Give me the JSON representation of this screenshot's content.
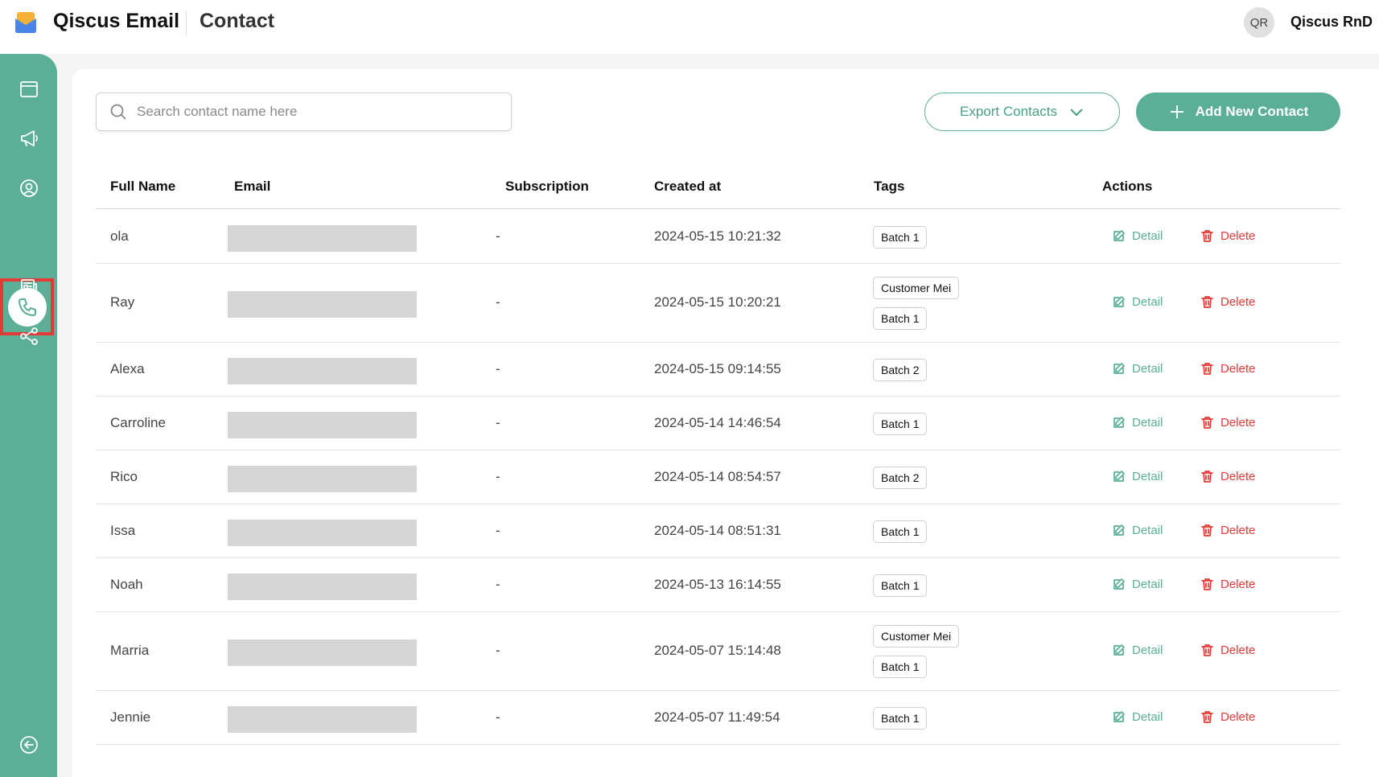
{
  "header": {
    "app_name": "Qiscus Email",
    "page_title": "Contact",
    "user_initials": "QR",
    "user_name": "Qiscus RnD"
  },
  "sidebar": {
    "items": [
      {
        "icon": "browser-window-icon"
      },
      {
        "icon": "megaphone-icon"
      },
      {
        "icon": "user-circle-icon"
      },
      {
        "icon": "phone-icon",
        "active": true
      },
      {
        "icon": "newspaper-icon"
      },
      {
        "icon": "share-nodes-icon"
      }
    ],
    "collapse_icon": "collapse-arrow-icon"
  },
  "toolbar": {
    "search_placeholder": "Search contact name here",
    "export_label": "Export Contacts",
    "add_label": "Add New Contact"
  },
  "table": {
    "columns": [
      "Full Name",
      "Email",
      "Subscription",
      "Created at",
      "Tags",
      "Actions"
    ],
    "detail_label": "Detail",
    "delete_label": "Delete",
    "rows": [
      {
        "name": "ola",
        "subscription": "-",
        "created_at": "2024-05-15 10:21:32",
        "tags": [
          "Batch 1"
        ]
      },
      {
        "name": "Ray",
        "subscription": "-",
        "created_at": "2024-05-15 10:20:21",
        "tags": [
          "Customer Mei",
          "Batch 1"
        ]
      },
      {
        "name": "Alexa",
        "subscription": "-",
        "created_at": "2024-05-15 09:14:55",
        "tags": [
          "Batch 2"
        ]
      },
      {
        "name": "Carroline",
        "subscription": "-",
        "created_at": "2024-05-14 14:46:54",
        "tags": [
          "Batch 1"
        ]
      },
      {
        "name": "Rico",
        "subscription": "-",
        "created_at": "2024-05-14 08:54:57",
        "tags": [
          "Batch 2"
        ]
      },
      {
        "name": "Issa",
        "subscription": "-",
        "created_at": "2024-05-14 08:51:31",
        "tags": [
          "Batch 1"
        ]
      },
      {
        "name": "Noah",
        "subscription": "-",
        "created_at": "2024-05-13 16:14:55",
        "tags": [
          "Batch 1"
        ]
      },
      {
        "name": "Marria",
        "subscription": "-",
        "created_at": "2024-05-07 15:14:48",
        "tags": [
          "Customer Mei",
          "Batch 1"
        ]
      },
      {
        "name": "Jennie",
        "subscription": "-",
        "created_at": "2024-05-07 11:49:54",
        "tags": [
          "Batch 1"
        ]
      }
    ]
  },
  "colors": {
    "accent": "#5baf96",
    "danger": "#e53935",
    "highlight_border": "#e53935"
  }
}
